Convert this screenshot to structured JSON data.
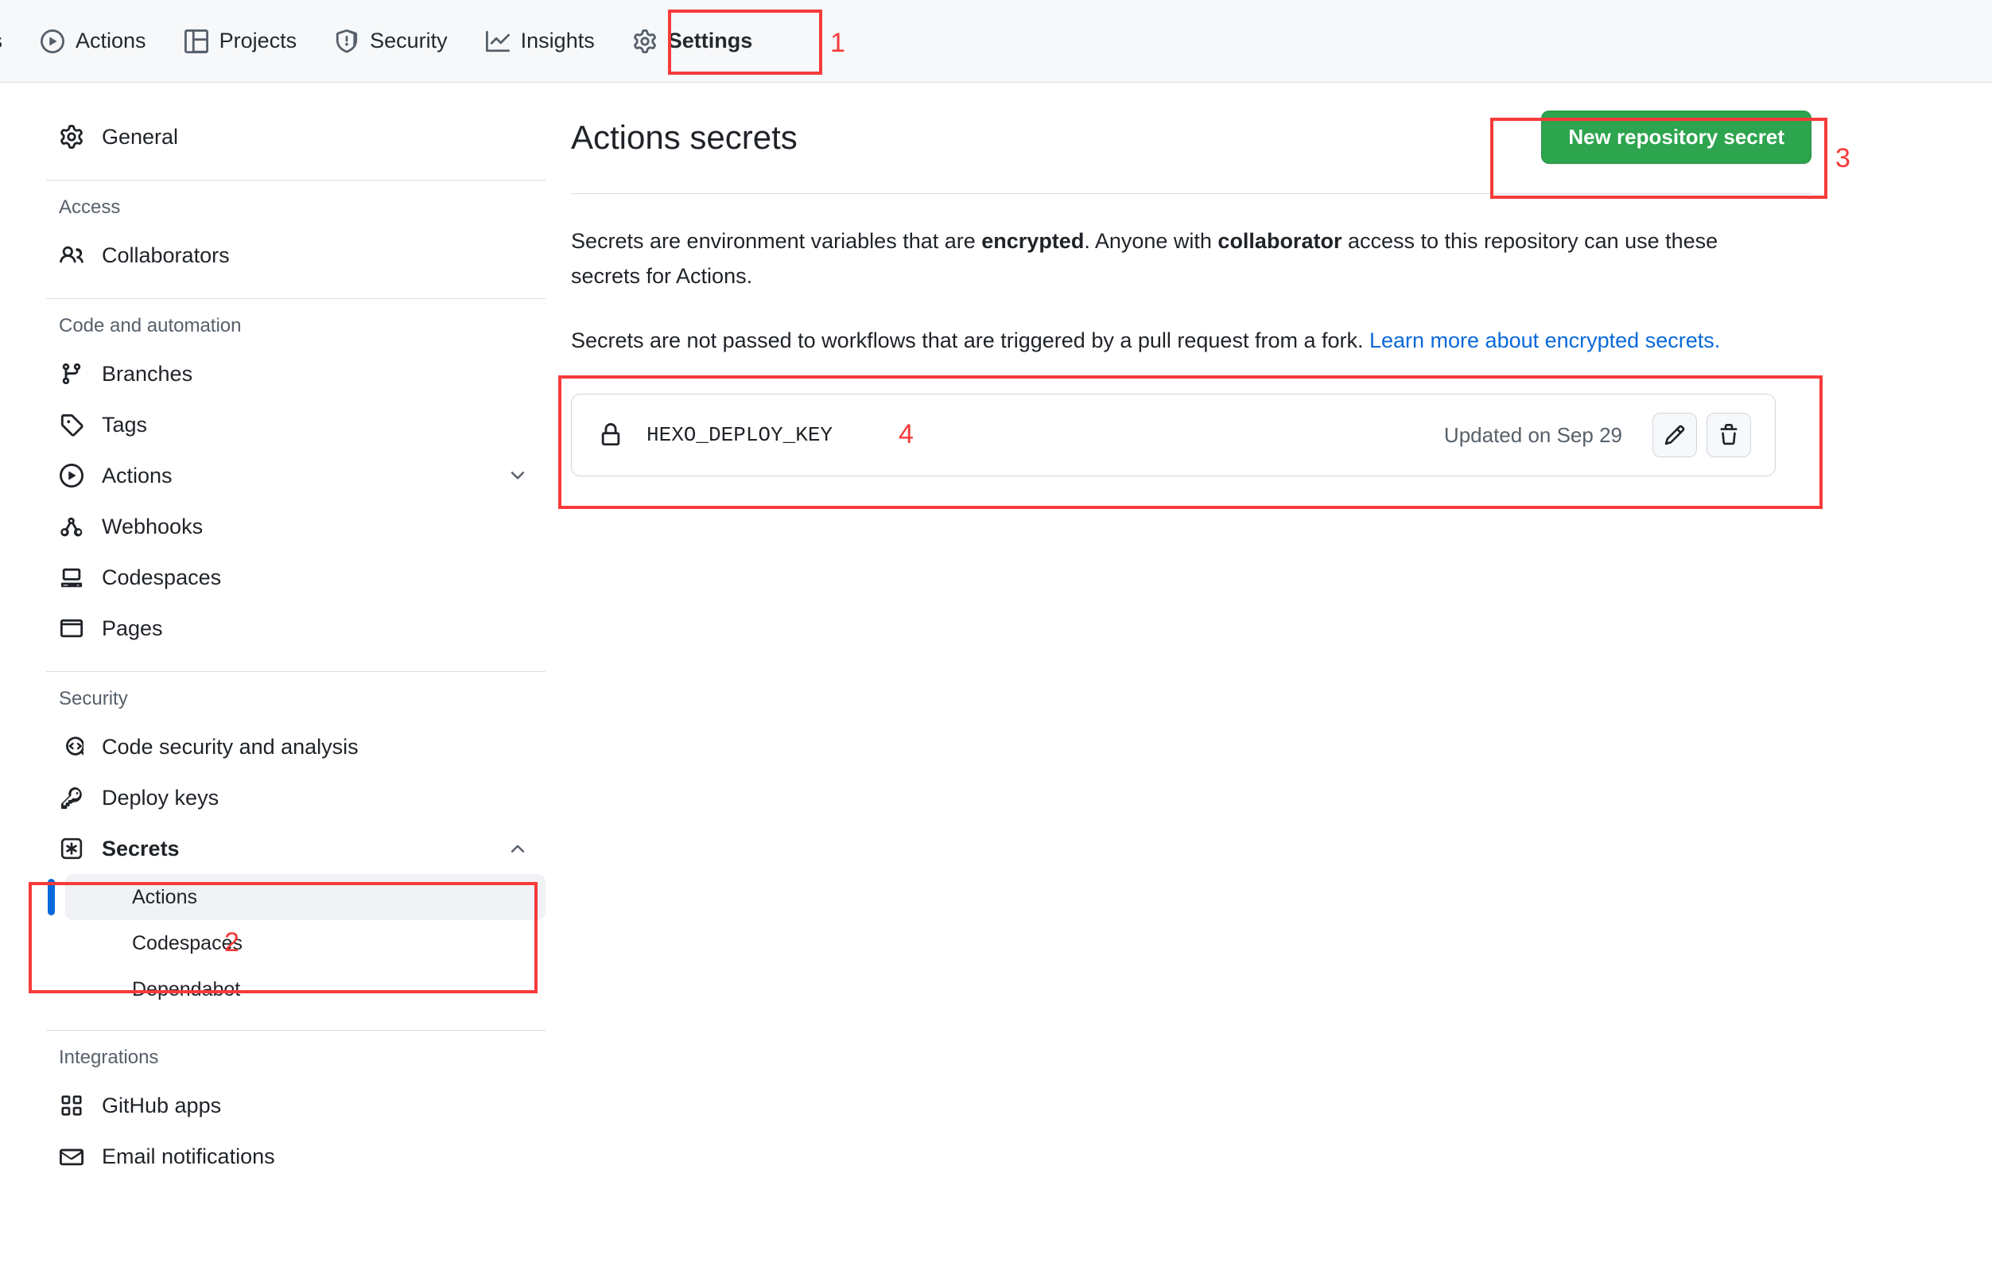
{
  "repo_nav": {
    "tabs": [
      {
        "label": "ts",
        "icon": "truncated-tab",
        "active": false,
        "truncated": true
      },
      {
        "label": "Actions",
        "icon": "play-circle-icon",
        "active": false
      },
      {
        "label": "Projects",
        "icon": "table-icon",
        "active": false
      },
      {
        "label": "Security",
        "icon": "shield-alert-icon",
        "active": false
      },
      {
        "label": "Insights",
        "icon": "graph-icon",
        "active": false
      },
      {
        "label": "Settings",
        "icon": "gear-icon",
        "active": true
      }
    ]
  },
  "sidebar": {
    "general": {
      "label": "General",
      "icon": "gear-icon"
    },
    "sections": [
      {
        "heading": "Access",
        "items": [
          {
            "label": "Collaborators",
            "icon": "people-icon"
          }
        ]
      },
      {
        "heading": "Code and automation",
        "items": [
          {
            "label": "Branches",
            "icon": "git-branch-icon"
          },
          {
            "label": "Tags",
            "icon": "tag-icon"
          },
          {
            "label": "Actions",
            "icon": "play-circle-icon",
            "chevron": "chevron-down-icon"
          },
          {
            "label": "Webhooks",
            "icon": "webhook-icon"
          },
          {
            "label": "Codespaces",
            "icon": "codespaces-icon"
          },
          {
            "label": "Pages",
            "icon": "browser-icon"
          }
        ]
      },
      {
        "heading": "Security",
        "items": [
          {
            "label": "Code security and analysis",
            "icon": "code-search-icon"
          },
          {
            "label": "Deploy keys",
            "icon": "key-icon"
          },
          {
            "label": "Secrets",
            "icon": "asterisk-box-icon",
            "chevron": "chevron-up-icon",
            "bold": true
          }
        ],
        "subitems": [
          {
            "label": "Actions",
            "selected": true
          },
          {
            "label": "Codespaces",
            "selected": false
          },
          {
            "label": "Dependabot",
            "selected": false
          }
        ]
      },
      {
        "heading": "Integrations",
        "items": [
          {
            "label": "GitHub apps",
            "icon": "apps-grid-icon"
          },
          {
            "label": "Email notifications",
            "icon": "mail-icon"
          }
        ]
      }
    ]
  },
  "main": {
    "title": "Actions secrets",
    "new_secret_button": "New repository secret",
    "paragraph1": {
      "part1": "Secrets are environment variables that are ",
      "bold1": "encrypted",
      "part2": ". Anyone with ",
      "bold2": "collaborator",
      "part3": " access to this repository can use these secrets for Actions."
    },
    "paragraph2": {
      "text": "Secrets are not passed to workflows that are triggered by a pull request from a fork. ",
      "link": "Learn more about encrypted secrets."
    },
    "secrets": [
      {
        "name": "HEXO_DEPLOY_KEY",
        "updated": "Updated on Sep 29",
        "lock_icon": "lock-icon",
        "edit_icon": "pencil-icon",
        "delete_icon": "trash-icon"
      }
    ]
  },
  "annotations": {
    "color": "#f73a3a",
    "markers": [
      {
        "number": "1",
        "target": "settings-tab"
      },
      {
        "number": "2",
        "target": "secrets-actions-sidebar"
      },
      {
        "number": "3",
        "target": "new-repository-secret-button"
      },
      {
        "number": "4",
        "target": "secret-row"
      }
    ]
  }
}
